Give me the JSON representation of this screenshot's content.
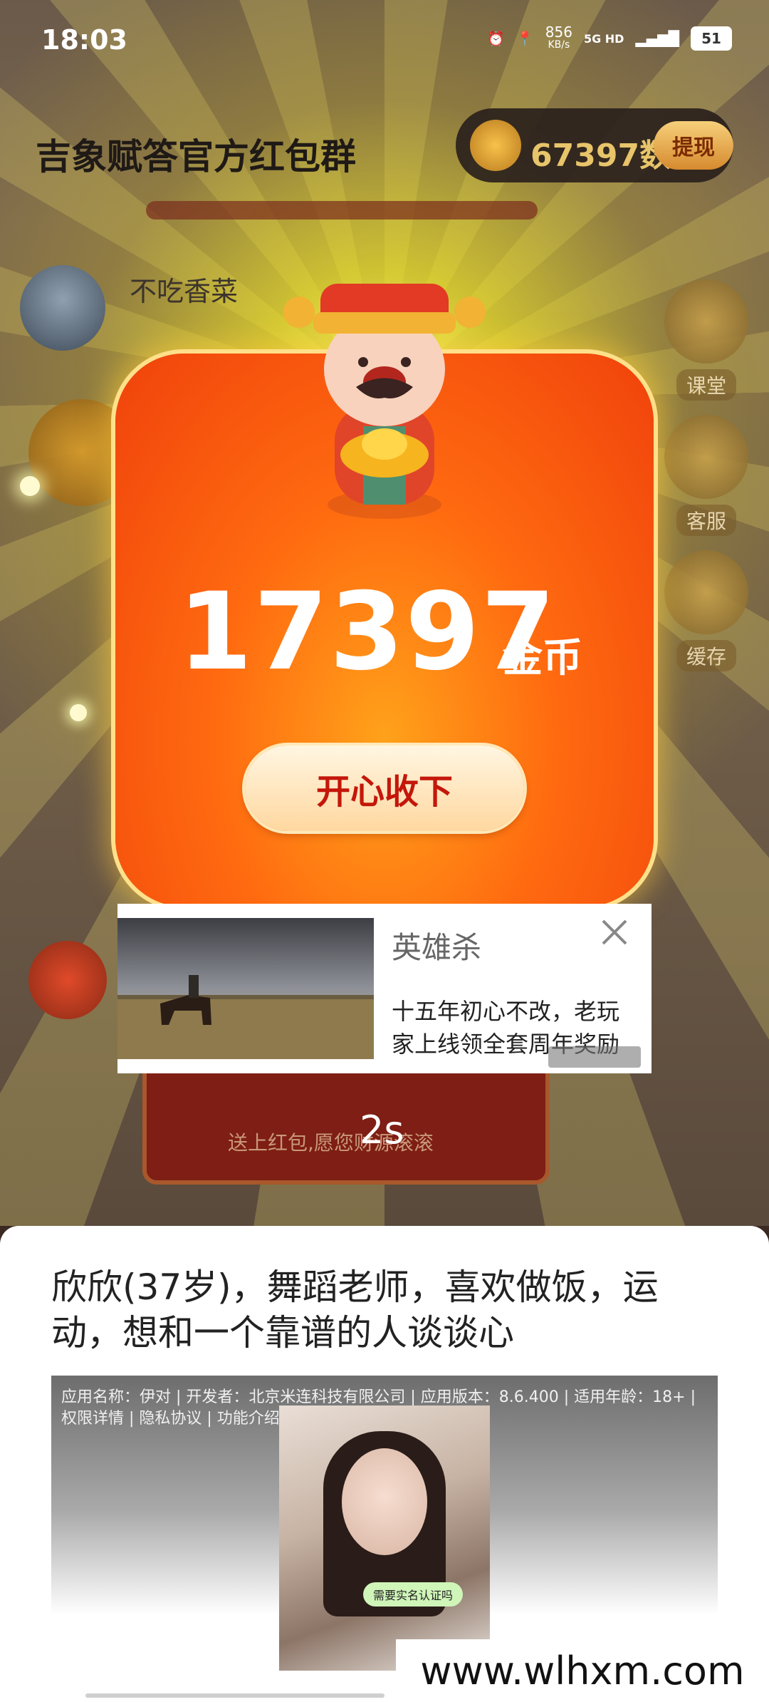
{
  "status_bar": {
    "time": "18:03",
    "net_speed_value": "856",
    "net_speed_unit": "KB/s",
    "network": "5G HD",
    "battery": "51"
  },
  "header": {
    "group_title": "吉象赋答官方红包群",
    "coin_pill_text": "67397数",
    "withdraw_label": "提现"
  },
  "chat": {
    "username": "不吃香菜",
    "packet_text": "送上红包,愿您财源滚滚"
  },
  "side_menu": [
    {
      "label": "课堂",
      "icon": "classroom-icon"
    },
    {
      "label": "客服",
      "icon": "customer-service-icon"
    },
    {
      "label": "缓存",
      "icon": "cache-icon"
    }
  ],
  "reward_popup": {
    "amount": "17397",
    "unit": "金币",
    "accept_label": "开心收下"
  },
  "ad_card": {
    "title": "英雄杀",
    "description": "十五年初心不改，老玩家上线领全套周年奖励",
    "countdown": "2s"
  },
  "bottom_sheet": {
    "headline": "欣欣(37岁)，舞蹈老师，喜欢做饭，运动，想和一个靠谱的人谈谈心",
    "app_info": "应用名称：伊对 | 开发者：北京米连科技有限公司 | 应用版本：8.6.400 | 适用年龄：18+ | 权限详情 | 隐私协议 | 功能介绍 | 备案信息",
    "photo_bubble": "需要实名认证吗"
  },
  "watermark": "www.wlhxm.com",
  "colors": {
    "popup_orange": "#ff6a10",
    "accept_text": "#c4170a",
    "ray_yellow": "#f2ea3a"
  }
}
